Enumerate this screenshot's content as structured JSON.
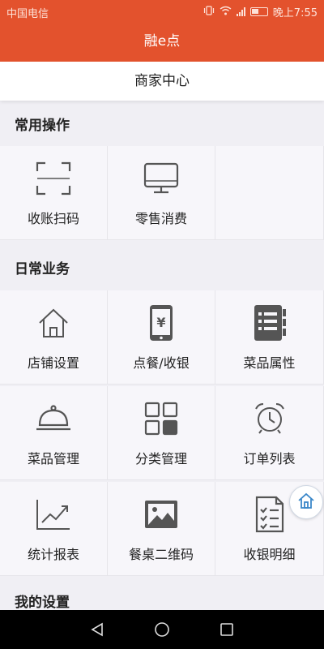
{
  "status_bar": {
    "carrier": "中国电信",
    "time": "晚上7:55",
    "network": "4G"
  },
  "app_bar": {
    "title": "融e点"
  },
  "sub_bar": {
    "title": "商家中心"
  },
  "sections": {
    "common": {
      "title": "常用操作",
      "items": [
        {
          "label": "收账扫码",
          "icon": "scan-icon"
        },
        {
          "label": "零售消费",
          "icon": "monitor-icon"
        }
      ]
    },
    "daily": {
      "title": "日常业务",
      "items": [
        {
          "label": "店铺设置",
          "icon": "house-icon"
        },
        {
          "label": "点餐/收银",
          "icon": "phone-yuan-icon"
        },
        {
          "label": "菜品属性",
          "icon": "notebook-list-icon"
        },
        {
          "label": "菜品管理",
          "icon": "food-cloche-icon"
        },
        {
          "label": "分类管理",
          "icon": "category-grid-icon"
        },
        {
          "label": "订单列表",
          "icon": "alarm-clock-icon"
        },
        {
          "label": "统计报表",
          "icon": "line-chart-icon"
        },
        {
          "label": "餐桌二维码",
          "icon": "image-icon"
        },
        {
          "label": "收银明细",
          "icon": "checklist-icon"
        }
      ]
    },
    "settings": {
      "title": "我的设置"
    }
  },
  "floating": {
    "icon": "home-icon"
  },
  "colors": {
    "accent": "#e3522d",
    "icon_gray": "#555555"
  }
}
